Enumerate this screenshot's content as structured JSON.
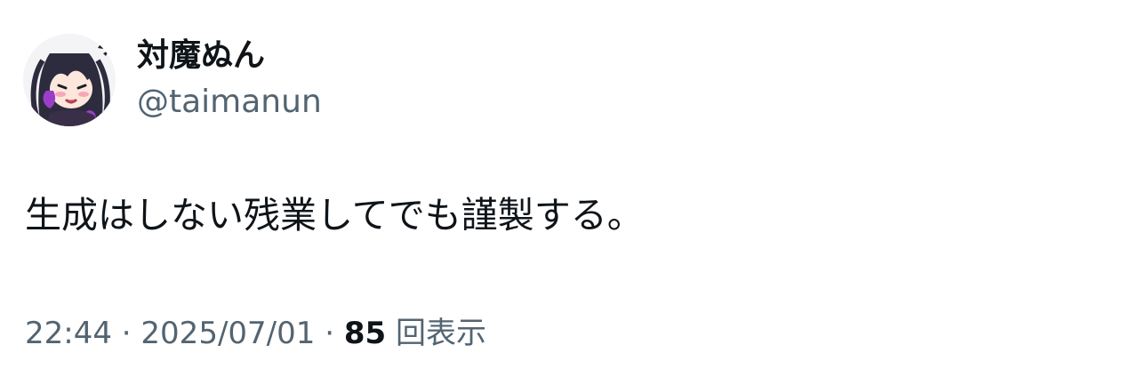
{
  "author": {
    "display_name": "対魔ぬん",
    "handle": "@taimanun",
    "avatar_icon": "anime-girl-avatar-icon"
  },
  "post": {
    "text": "生成はしない残業してでも謹製する。"
  },
  "meta": {
    "time": "22:44",
    "separator": " · ",
    "date": "2025/07/01",
    "views_count": "85",
    "views_label": "回表示"
  },
  "colors": {
    "primary_text": "#0f1419",
    "secondary_text": "#536471",
    "background": "#ffffff"
  }
}
